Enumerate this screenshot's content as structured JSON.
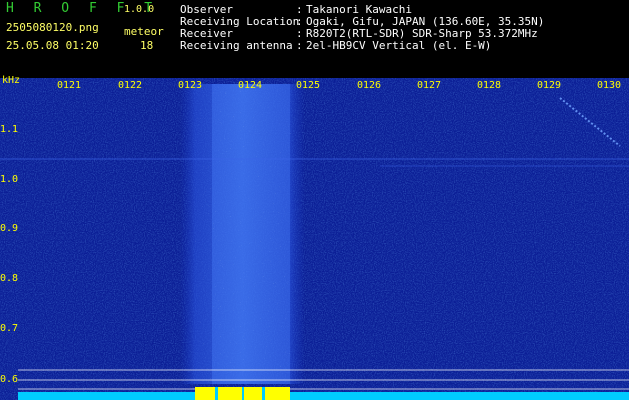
{
  "app": {
    "name": "H R O F F T",
    "version": "1.0.0"
  },
  "file": {
    "name": "2505080120.png",
    "datetime": "25.05.08 01:20"
  },
  "meteor": {
    "label": "meteor",
    "count": "18"
  },
  "info": [
    {
      "label": "Observer",
      "value": "Takanori Kawachi"
    },
    {
      "label": "Receiving Location",
      "value": "Ogaki, Gifu, JAPAN (136.60E, 35.35N)"
    },
    {
      "label": "Receiver",
      "value": "R820T2(RTL-SDR) SDR-Sharp 53.372MHz"
    },
    {
      "label": "Receiving antenna",
      "value": "2el-HB9CV Vertical (el. E-W)"
    }
  ],
  "info_separator": ":",
  "axis": {
    "unit": "kHz",
    "y_ticks": [
      "1.1",
      "1.0",
      "0.9",
      "0.8",
      "0.7",
      "0.6"
    ],
    "time_ticks": [
      "0121",
      "0122",
      "0123",
      "0124",
      "0125",
      "0126",
      "0127",
      "0128",
      "0129",
      "0130"
    ]
  },
  "colors": {
    "header_title": "#33cc33",
    "header_version": "#ffff66",
    "header_text": "#ffffff",
    "axis_text": "#ffff00",
    "spectrogram_bg": "#0a1a8a",
    "signal_band": "#2a55e0",
    "signal_core": "#ccffcc",
    "noise_floor": "#00ccff",
    "peak_bar": "#ffff00",
    "reference_line": "#ffffff"
  }
}
